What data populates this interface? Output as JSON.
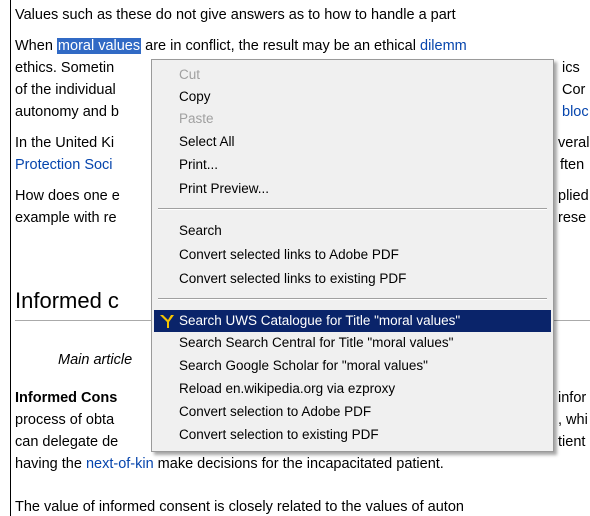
{
  "article": {
    "line1": "Values such as these do not give answers as to how to handle a part",
    "line2_pre": "When ",
    "line2_sel": "moral values",
    "line2_mid": " are in conflict, the result may be an ethical ",
    "line2_link": "dilemm",
    "line3_a": "ethics. Sometin",
    "line3_b": "ics",
    "line4_a": "of the individual",
    "line4_b": "Cor",
    "line5_a": "autonomy and b",
    "line5_b": "bloc",
    "line6_a": "In the United Ki",
    "line6_b": "veral",
    "line7_a": "Protection Soci",
    "line7_b": "ften",
    "line8_a": "How does one e",
    "line8_b": "plied",
    "line9_a": "example with re",
    "line9_b": "rese",
    "heading": "Informed c",
    "main_article": "Main article",
    "line10_a": "Informed Cons",
    "line10_b": "infor",
    "line11_a": "process of obta",
    "line11_b": ", whi",
    "line12_a": "can delegate de",
    "line12_b": "tient",
    "line13_pre": "having the ",
    "line13_link": "next-of-kin",
    "line13_post": " make decisions for the incapacitated patient.",
    "line14": "The value of informed consent is closely related to the values of auton"
  },
  "menu": {
    "cut": "Cut",
    "copy": "Copy",
    "paste": "Paste",
    "select_all": "Select All",
    "print": "Print...",
    "print_preview": "Print Preview...",
    "search": "Search",
    "convert_links_adobe": "Convert selected links to Adobe PDF",
    "convert_links_existing": "Convert selected links to existing PDF",
    "search_uws": "Search UWS Catalogue for Title \"moral values\"",
    "search_central": "Search Search Central for Title \"moral values\"",
    "search_scholar": "Search Google Scholar for \"moral values\"",
    "reload_ezproxy": "Reload en.wikipedia.org via ezproxy",
    "convert_sel_adobe": "Convert selection to Adobe PDF",
    "convert_sel_existing": "Convert selection to existing PDF",
    "highlight_icon": "uws-logo-icon"
  },
  "colors": {
    "selection": "#316ac5",
    "menu_highlight": "#0a246a",
    "link": "#0645ad",
    "menu_bg": "#f0f0f0"
  }
}
